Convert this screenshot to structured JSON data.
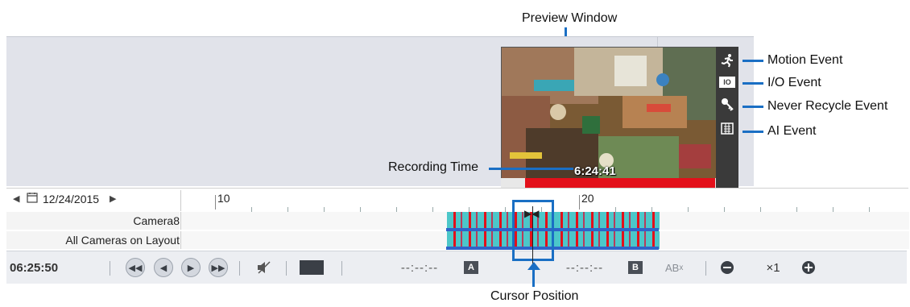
{
  "callouts": {
    "preview_window": "Preview Window",
    "motion_event": "Motion Event",
    "io_event": "I/O Event",
    "never_recycle_event": "Never Recycle Event",
    "ai_event": "AI Event",
    "recording_time": "Recording Time",
    "cursor_position": "Cursor Position"
  },
  "preview": {
    "timestamp": "6:24:41",
    "sidebar_icons": [
      "running-person-icon",
      "io-icon",
      "key-icon",
      "ai-icon"
    ],
    "io_label": "IO"
  },
  "timeline": {
    "date": "12/24/2015",
    "hour_labels": [
      "10",
      "20"
    ],
    "rows": [
      {
        "label": "Camera8"
      },
      {
        "label": "All Cameras on Layout"
      }
    ]
  },
  "controls": {
    "time": "06:25:50",
    "mark_a_time": "--:--:--",
    "mark_a_label": "A",
    "mark_b_time": "--:--:--",
    "mark_b_label": "B",
    "ab_label": "AB",
    "ab_sup": "x",
    "speed": "×1"
  },
  "colors": {
    "accent_blue": "#1a6fc4",
    "recording_red": "#e3101a",
    "event_cyan": "#4cc7c9"
  }
}
